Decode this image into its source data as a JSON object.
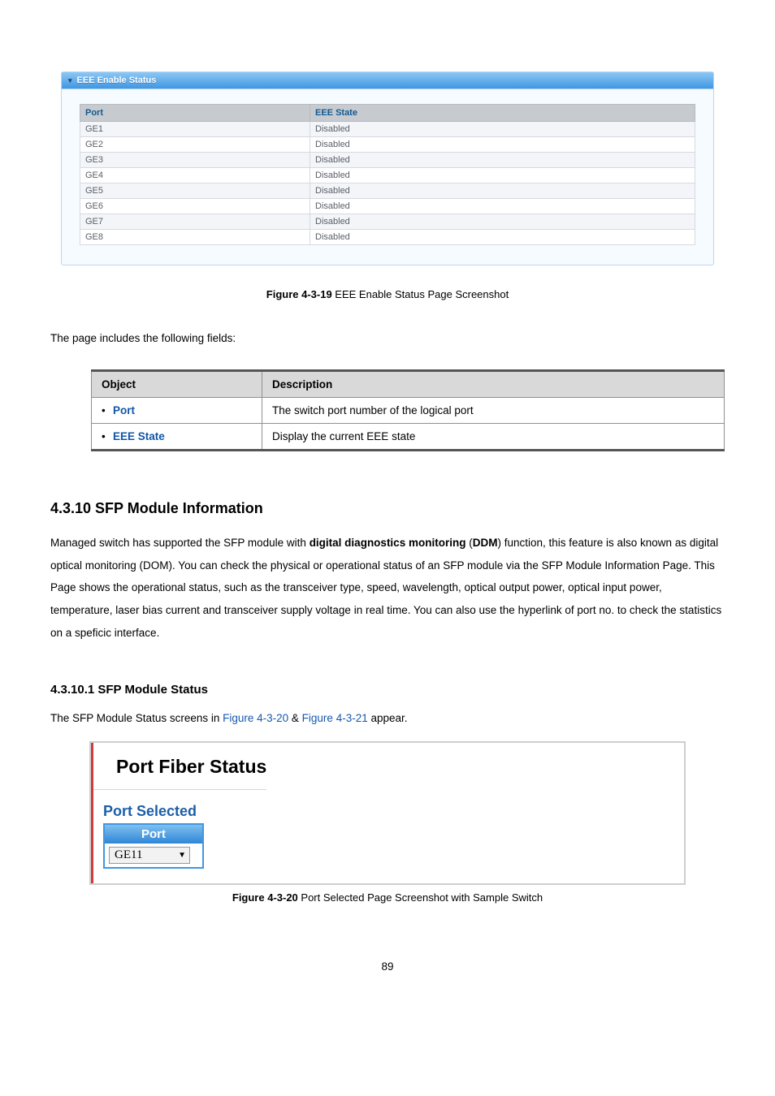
{
  "eee_panel": {
    "title": "EEE Enable Status",
    "columns": {
      "port": "Port",
      "state": "EEE State"
    },
    "rows": [
      {
        "port": "GE1",
        "state": "Disabled"
      },
      {
        "port": "GE2",
        "state": "Disabled"
      },
      {
        "port": "GE3",
        "state": "Disabled"
      },
      {
        "port": "GE4",
        "state": "Disabled"
      },
      {
        "port": "GE5",
        "state": "Disabled"
      },
      {
        "port": "GE6",
        "state": "Disabled"
      },
      {
        "port": "GE7",
        "state": "Disabled"
      },
      {
        "port": "GE8",
        "state": "Disabled"
      }
    ]
  },
  "figure1": {
    "label": "Figure 4-3-19",
    "caption": " EEE Enable Status Page Screenshot"
  },
  "intro_line": "The page includes the following fields:",
  "obj_table": {
    "head": {
      "c1": "Object",
      "c2": "Description"
    },
    "rows": [
      {
        "key": "Port",
        "desc": "The switch port number of the logical port"
      },
      {
        "key": "EEE State",
        "desc": "Display the current EEE state"
      }
    ]
  },
  "section": {
    "heading": "4.3.10 SFP Module Information",
    "para_parts": {
      "p1a": "Managed switch has supported the SFP module with ",
      "p1b": "digital diagnostics monitoring",
      "p1c": " (",
      "p1d": "DDM",
      "p1e": ") function, this feature is also known as digital optical monitoring (DOM). You can check the physical or operational status of an SFP module via the SFP Module Information Page. This Page shows the operational status, such as the transceiver type, speed, wavelength, optical output power, optical input power, temperature, laser bias current and transceiver supply voltage in real time. You can also use the hyperlink of port no. to check the statistics on a speficic interface."
    }
  },
  "subsection": {
    "heading": "4.3.10.1 SFP Module Status",
    "line_parts": {
      "a": "The SFP Module Status screens in ",
      "b": "Figure 4-3-20",
      "c": " & ",
      "d": "Figure 4-3-21",
      "e": " appear."
    }
  },
  "fiber_panel": {
    "title": "Port Fiber Status",
    "section_label": "Port Selected",
    "port_header": "Port",
    "port_value": "GE11"
  },
  "figure2": {
    "label": "Figure 4-3-20",
    "caption": " Port Selected Page Screenshot with Sample Switch"
  },
  "page_number": "89"
}
